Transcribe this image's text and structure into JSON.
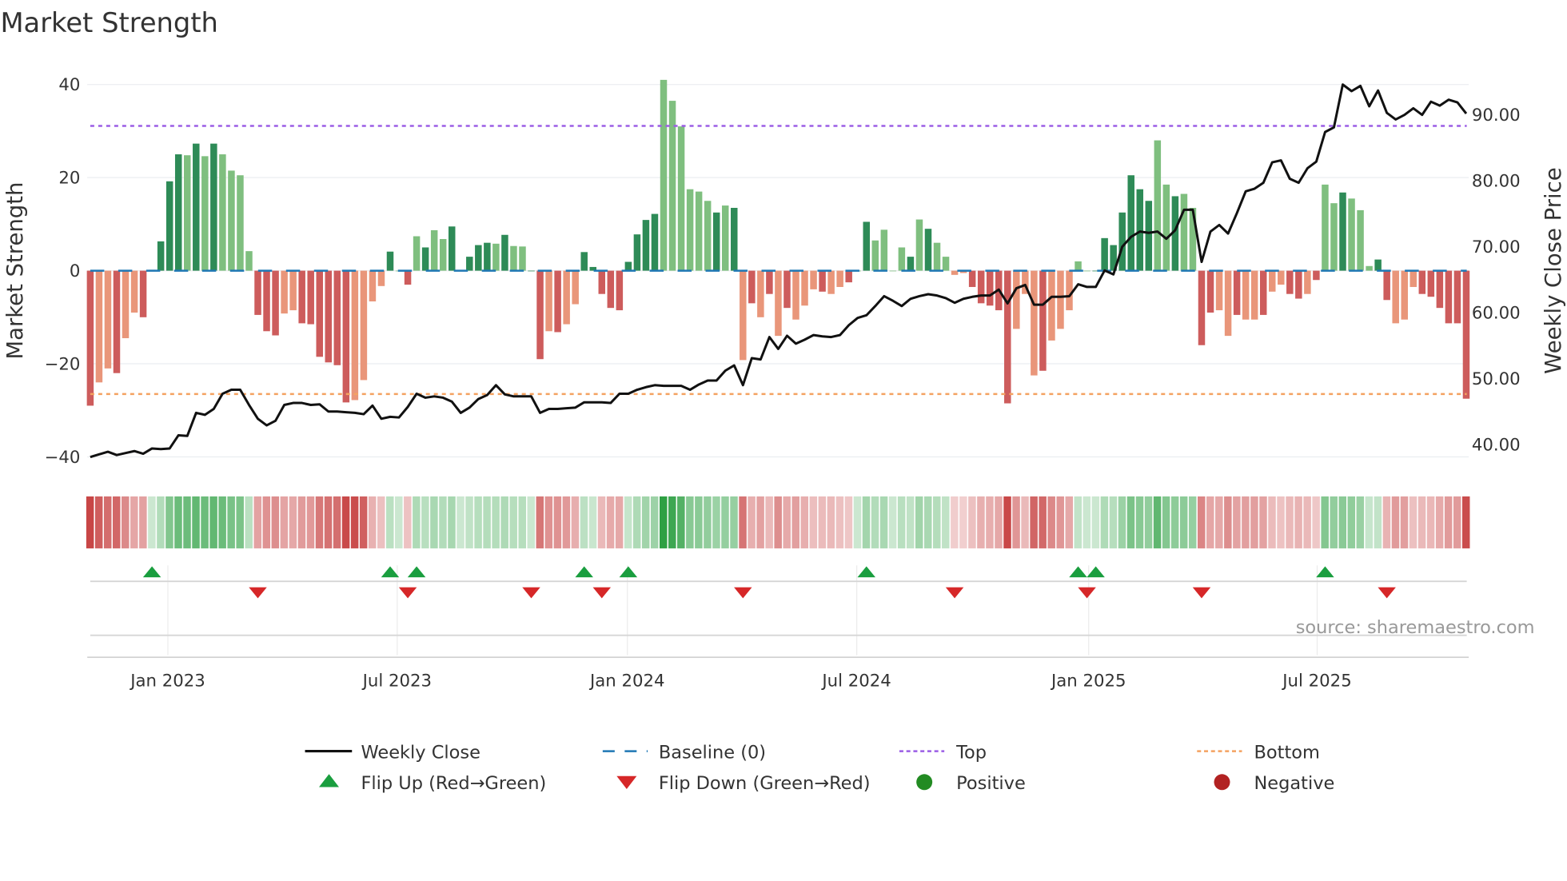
{
  "chart_data": {
    "type": "bar",
    "title": "Market Strength",
    "ylabel": "Market Strength",
    "y2label": "Weekly Close Price",
    "ylim": [
      -44,
      44
    ],
    "y2lim": [
      36.6,
      97.2
    ],
    "yticks": [
      {
        "v": 40,
        "label": "40"
      },
      {
        "v": 20,
        "label": "20"
      },
      {
        "v": 0,
        "label": "0"
      },
      {
        "v": -20,
        "label": "−20"
      },
      {
        "v": -40,
        "label": "−40"
      }
    ],
    "y2ticks": [
      {
        "v": 90,
        "label": "90.00"
      },
      {
        "v": 80,
        "label": "80.00"
      },
      {
        "v": 70,
        "label": "70.00"
      },
      {
        "v": 60,
        "label": "60.00"
      },
      {
        "v": 50,
        "label": "50.00"
      },
      {
        "v": 40,
        "label": "40.00"
      }
    ],
    "xticks": [
      {
        "week": 8.8,
        "label": "Jan 2023"
      },
      {
        "week": 34.8,
        "label": "Jul 2023"
      },
      {
        "week": 60.9,
        "label": "Jan 2024"
      },
      {
        "week": 86.9,
        "label": "Jul 2024"
      },
      {
        "week": 113.2,
        "label": "Jan 2025"
      },
      {
        "week": 139.1,
        "label": "Jul 2025"
      }
    ],
    "top_level": 31.1,
    "bottom_level": -26.5,
    "strength": [
      -29,
      -24,
      -21,
      -22,
      -14.5,
      -9,
      -10,
      0.2,
      6.3,
      19.2,
      25,
      24.8,
      27.3,
      24.6,
      27.3,
      25,
      21.5,
      20.5,
      4.2,
      -9.5,
      -13,
      -13.9,
      -9.2,
      -8.5,
      -11.3,
      -11.5,
      -18.5,
      -19.7,
      -20.3,
      -28.3,
      -27.8,
      -23.5,
      -6.6,
      -3.3,
      4.1,
      0,
      -3,
      7.4,
      5,
      8.7,
      6.8,
      9.5,
      0,
      3,
      5.5,
      6,
      5.8,
      7.7,
      5.3,
      5.2,
      0,
      -19,
      -13,
      -13.2,
      -11.5,
      -7.2,
      4,
      0.8,
      -5,
      -8,
      -8.5,
      1.9,
      7.8,
      10.9,
      12.2,
      41,
      36.5,
      31,
      17.5,
      17,
      15,
      12.5,
      14,
      13.5,
      -19.2,
      -7,
      -10,
      -5,
      -14,
      -8,
      -10.5,
      -7.5,
      -4,
      -4.5,
      -5,
      -3.5,
      -2.5,
      0,
      10.5,
      6.5,
      8.8,
      0,
      5,
      3,
      11,
      9,
      6,
      3,
      -0.9,
      -0.5,
      -3.5,
      -7,
      -7.5,
      -8.5,
      -28.5,
      -12.5,
      -5,
      -22.5,
      -21.5,
      -15,
      -12.5,
      -8.5,
      2,
      0,
      0,
      7,
      5.5,
      12.5,
      20.5,
      17.5,
      15,
      28,
      18.5,
      16,
      16.5,
      13.5,
      -16,
      -9,
      -8.5,
      -14,
      -9.5,
      -10.5,
      -10.5,
      -9.5,
      -4.5,
      -3,
      -5,
      -6,
      -5,
      -2,
      18.5,
      14.5,
      16.8,
      15.5,
      13,
      1,
      2.4,
      -6.3,
      -11.3,
      -10.5,
      -3.5,
      -5,
      -5.6,
      -8,
      -11.3,
      -11.3,
      -27.5
    ],
    "shade": "dlldlldldddldldlllldddllddddddlllldldldlldddddldllddldlldddddddddlllllldldldldldllldlldldlllldldlllldddddllldllllldddddddlldllddlldlldllddldlldlllddllldddddd",
    "close": [
      38.1,
      38.5,
      38.9,
      38.4,
      38.7,
      39.0,
      38.6,
      39.4,
      39.3,
      39.4,
      41.4,
      41.3,
      44.8,
      44.5,
      45.4,
      47.7,
      48.3,
      48.3,
      46.0,
      43.9,
      42.9,
      43.6,
      46.0,
      46.3,
      46.3,
      46.0,
      46.1,
      45.0,
      45.0,
      44.9,
      44.8,
      44.6,
      45.9,
      43.9,
      44.2,
      44.1,
      45.7,
      47.7,
      47.1,
      47.3,
      47.1,
      46.5,
      44.8,
      45.6,
      46.9,
      47.5,
      49.0,
      47.6,
      47.3,
      47.3,
      47.3,
      44.8,
      45.4,
      45.4,
      45.5,
      45.6,
      46.4,
      46.4,
      46.4,
      46.3,
      47.7,
      47.7,
      48.3,
      48.7,
      49.0,
      48.9,
      48.9,
      48.9,
      48.3,
      49.1,
      49.7,
      49.7,
      51.2,
      52.0,
      49.0,
      53.1,
      52.9,
      56.3,
      54.5,
      56.5,
      55.3,
      55.9,
      56.6,
      56.4,
      56.3,
      56.6,
      58.1,
      59.2,
      59.6,
      61.0,
      62.5,
      61.8,
      61.0,
      62.1,
      62.5,
      62.8,
      62.6,
      62.2,
      61.5,
      62.1,
      62.4,
      62.6,
      62.6,
      63.5,
      61.4,
      63.7,
      64.2,
      61.2,
      61.2,
      62.4,
      62.4,
      62.5,
      64.3,
      63.9,
      63.9,
      66.4,
      65.8,
      70.0,
      71.5,
      72.3,
      72.1,
      72.3,
      71.2,
      72.5,
      75.6,
      75.6,
      67.7,
      72.3,
      73.3,
      72.0,
      75.1,
      78.4,
      78.8,
      79.7,
      82.8,
      83.1,
      80.3,
      79.7,
      81.9,
      82.9,
      87.4,
      88.1,
      94.6,
      93.6,
      94.4,
      91.3,
      93.7,
      90.3,
      89.3,
      90.0,
      91.0,
      90.0,
      92.0,
      91.4,
      92.3,
      91.9,
      90.2
    ],
    "flip_up_weeks": [
      7,
      34,
      37,
      56,
      61,
      88,
      112,
      114,
      140
    ],
    "flip_down_weeks": [
      19,
      36,
      50,
      58,
      74,
      98,
      113,
      126,
      147
    ],
    "legend": {
      "weekly_close": "Weekly Close",
      "baseline": "Baseline (0)",
      "top": "Top",
      "bottom": "Bottom",
      "flip_up": "Flip Up (Red→Green)",
      "flip_down": "Flip Down (Green→Red)",
      "positive": "Positive",
      "negative": "Negative"
    },
    "legend_placement": "bottom",
    "source": "source: sharemaestro.com",
    "colors": {
      "pos_dark": "#2e8b57",
      "pos_light": "#7fbf7f",
      "neg_dark": "#cd5c5c",
      "neg_light": "#e9967a",
      "line": "#111111",
      "baseline": "#1f77b4",
      "top": "#9b5de5",
      "bottom": "#f4a261",
      "flip_up": "#1a9e3f",
      "flip_down": "#d62728",
      "positive": "#228b22",
      "negative": "#b22222"
    }
  }
}
